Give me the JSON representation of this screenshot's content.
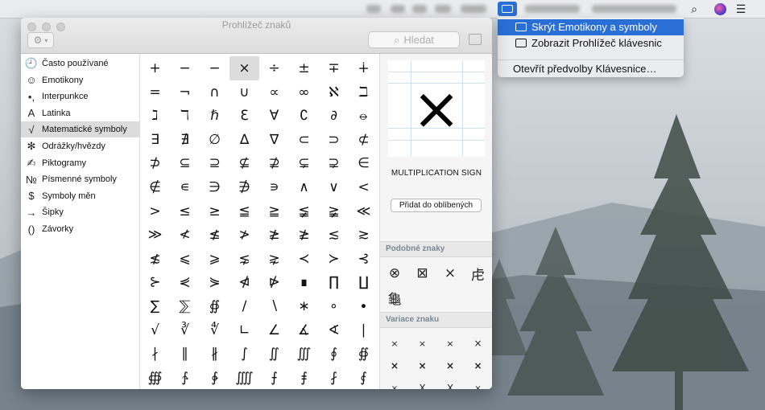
{
  "window": {
    "title": "Prohlížeč znaků",
    "search_placeholder": "Hledat"
  },
  "menu": {
    "items": [
      {
        "label": "Skrýt Emotikony a symboly",
        "selected": true
      },
      {
        "label": "Zobrazit Prohlížeč klávesnic",
        "selected": false
      },
      {
        "label": "Otevřít předvolby Klávesnice…",
        "selected": false
      }
    ]
  },
  "sidebar": {
    "items": [
      {
        "icon": "🕘",
        "icon_name": "clock-icon",
        "label": "Často používané"
      },
      {
        "icon": "☺",
        "icon_name": "smiley-icon",
        "label": "Emotikony"
      },
      {
        "icon": "•,",
        "icon_name": "punctuation-icon",
        "label": "Interpunkce"
      },
      {
        "icon": "A",
        "icon_name": "latin-letter-icon",
        "label": "Latinka"
      },
      {
        "icon": "√",
        "icon_name": "square-root-icon",
        "label": "Matematické symboly",
        "active": true
      },
      {
        "icon": "✻",
        "icon_name": "asterisk-icon",
        "label": "Odrážky/hvězdy"
      },
      {
        "icon": "✍",
        "icon_name": "pictograph-icon",
        "label": "Piktogramy"
      },
      {
        "icon": "№",
        "icon_name": "numero-icon",
        "label": "Písmenné symboly"
      },
      {
        "icon": "$",
        "icon_name": "dollar-icon",
        "label": "Symboly měn"
      },
      {
        "icon": "→",
        "icon_name": "arrow-icon",
        "label": "Šipky"
      },
      {
        "icon": "()",
        "icon_name": "parentheses-icon",
        "label": "Závorky"
      }
    ]
  },
  "grid": {
    "rows": [
      [
        "+",
        "−",
        "−",
        "×",
        "÷",
        "±",
        "∓",
        "∔"
      ],
      [
        "=",
        "¬",
        "∩",
        "∪",
        "∝",
        "∞",
        "ℵ",
        "ℶ"
      ],
      [
        "ℷ",
        "ℸ",
        "ℏ",
        "ℇ",
        "∀",
        "∁",
        "∂",
        "⦵"
      ],
      [
        "∃",
        "∄",
        "∅",
        "∆",
        "∇",
        "⊂",
        "⊃",
        "⊄"
      ],
      [
        "⊅",
        "⊆",
        "⊇",
        "⊈",
        "⊉",
        "⊊",
        "⊋",
        "∈"
      ],
      [
        "∉",
        "∊",
        "∋",
        "∌",
        "∍",
        "∧",
        "∨",
        "<"
      ],
      [
        ">",
        "≤",
        "≥",
        "≦",
        "≧",
        "≨",
        "≩",
        "≪"
      ],
      [
        "≫",
        "≮",
        "≰",
        "≯",
        "≱",
        "≱",
        "≲",
        "≳"
      ],
      [
        "≴",
        "⩽",
        "⩾",
        "⋦",
        "⋧",
        "≺",
        "≻",
        "⊰"
      ],
      [
        "⊱",
        "⋞",
        "⋟",
        "⋪",
        "⋫",
        "∎",
        "∏",
        "∐"
      ],
      [
        "∑",
        "⅀",
        "∯",
        "∕",
        "∖",
        "∗",
        "∘",
        "∙"
      ],
      [
        "√",
        "∛",
        "∜",
        "∟",
        "∠",
        "∡",
        "∢",
        "∣"
      ],
      [
        "∤",
        "∥",
        "∦",
        "∫",
        "∬",
        "∭",
        "∮",
        "∯"
      ],
      [
        "∰",
        "∱",
        "∲",
        "⨌",
        "⨍",
        "⨎",
        "⨏",
        "⨐"
      ]
    ],
    "selected_row": 0,
    "selected_col": 3
  },
  "detail": {
    "glyph": "×",
    "name": "MULTIPLICATION SIGN",
    "favorite_label": "Přidat do oblíbených",
    "similar_heading": "Podobné znaky",
    "similar": [
      "⊗",
      "⊠",
      "×",
      "⾌",
      "⿔"
    ],
    "variants_heading": "Variace znaku",
    "variants": [
      "×",
      "×",
      "×",
      "×",
      "×",
      "×",
      "×",
      "×",
      "×",
      "X",
      "X",
      "×"
    ]
  },
  "colors": {
    "accent": "#2a6fd6",
    "section_heading": "#7a8895"
  }
}
